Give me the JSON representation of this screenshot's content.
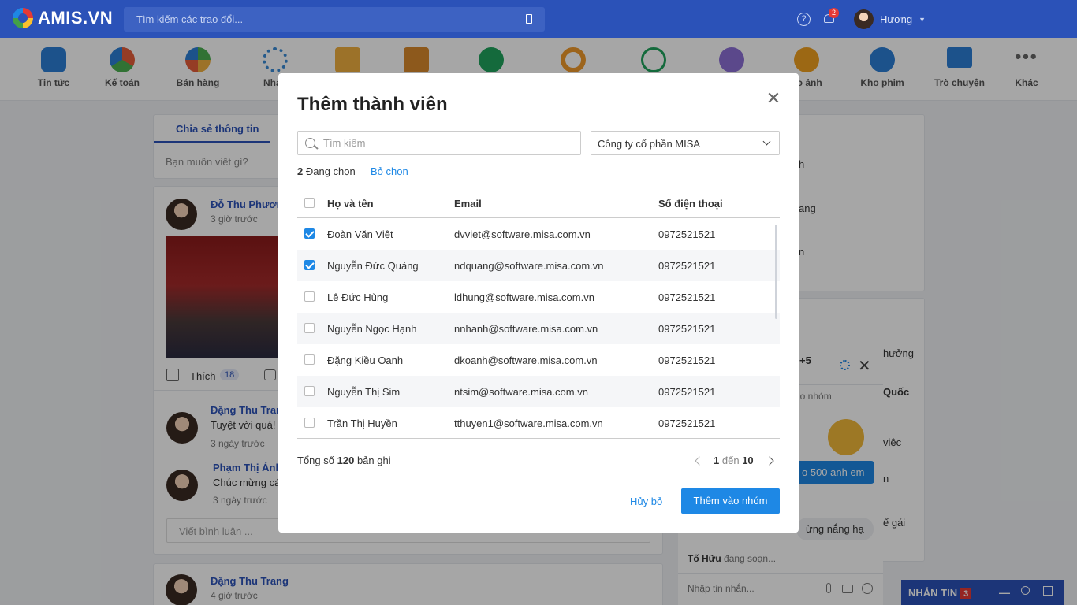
{
  "topbar": {
    "logo": "AMIS.VN",
    "search_placeholder": "Tìm kiếm các trao đổi...",
    "notifications_count": "2",
    "user_name": "Hương"
  },
  "apps": [
    {
      "label": "Tin tức",
      "icon": "news-icon",
      "color": "#2b7fd6"
    },
    {
      "label": "Kế toán",
      "icon": "accounting-icon",
      "color": "#e55d3a"
    },
    {
      "label": "Bán hàng",
      "icon": "sales-icon",
      "color": "#4caf50"
    },
    {
      "label": "Nhân",
      "icon": "hr-icon",
      "color": "#3a8bd6"
    },
    {
      "label": "",
      "icon": "folder-icon",
      "color": "#f0b040"
    },
    {
      "label": "",
      "icon": "box-icon",
      "color": "#d9892b"
    },
    {
      "label": "",
      "icon": "check-icon",
      "color": "#1fa45c"
    },
    {
      "label": "",
      "icon": "ring-icon",
      "color": "#f09a2b"
    },
    {
      "label": "",
      "icon": "download-icon",
      "color": "#1fa45c"
    },
    {
      "label": "",
      "icon": "person-icon",
      "color": "#8c6fd6"
    },
    {
      "label": "ho ảnh",
      "icon": "photo-icon",
      "color": "#f0a020"
    },
    {
      "label": "Kho phim",
      "icon": "video-icon",
      "color": "#2b7fd6"
    },
    {
      "label": "Trò chuyện",
      "icon": "mail-icon",
      "color": "#2b7fd6"
    },
    {
      "label": "Khác",
      "icon": "more-icon",
      "color": "#666666"
    }
  ],
  "feed": {
    "tab": "Chia sẻ thông tin",
    "compose_placeholder": "Bạn muốn viết gì?",
    "post1_author": "Đỗ Thu Phương",
    "post1_time": "3 giờ trước",
    "like_label": "Thích",
    "like_count": "18",
    "c1_author": "Đặng Thu Trang",
    "c1_text": "Tuyệt vời quá! C",
    "c1_time": "3 ngày trước",
    "c2_author": "Phạm Thị Ánh",
    "c2_text": "Chúc mừng cá",
    "c2_time": "3 ngày trước",
    "comment_placeholder": "Viết bình luận ...",
    "post2_author": "Đặng Thu Trang",
    "post2_time": "4 giờ trước"
  },
  "side": {
    "t1": "h",
    "t2": "ang",
    "t3": "n",
    "t4": "hưởng",
    "t5": "Quốc",
    "t6": "việc",
    "t7": "n",
    "t8": "ế gái"
  },
  "chat": {
    "plus": "+5",
    "group_line": "ào nhóm",
    "bubble": "o 500 anh em",
    "msg2": "ừng nắng hạ",
    "typing_name": "Tố Hữu",
    "typing_text": "đang soạn...",
    "input_placeholder": "Nhập tin nhắn..."
  },
  "msgbar": {
    "label": "NHẮN TIN",
    "count": "3"
  },
  "modal": {
    "title": "Thêm thành viên",
    "search_placeholder": "Tìm kiếm",
    "company": "Công ty cổ phần MISA",
    "selected_count": "2",
    "selected_label": "Đang chọn",
    "unselect": "Bỏ chọn",
    "columns": {
      "name": "Họ và tên",
      "email": "Email",
      "phone": "Số điện thoại"
    },
    "rows": [
      {
        "name": "Đoàn Văn Việt",
        "email": "dvviet@software.misa.com.vn",
        "phone": "0972521521",
        "checked": true
      },
      {
        "name": "Nguyễn Đức Quảng",
        "email": "ndquang@software.misa.com.vn",
        "phone": "0972521521",
        "checked": true
      },
      {
        "name": "Lê Đức Hùng",
        "email": "ldhung@software.misa.com.vn",
        "phone": "0972521521",
        "checked": false
      },
      {
        "name": "Nguyễn Ngọc Hạnh",
        "email": "nnhanh@software.misa.com.vn",
        "phone": "0972521521",
        "checked": false
      },
      {
        "name": "Đặng Kiều Oanh",
        "email": "dkoanh@software.misa.com.vn",
        "phone": "0972521521",
        "checked": false
      },
      {
        "name": "Nguyễn Thị Sim",
        "email": "ntsim@software.misa.com.vn",
        "phone": "0972521521",
        "checked": false
      },
      {
        "name": "Trần Thị Huyền",
        "email": "tthuyen1@software.misa.com.vn",
        "phone": "0972521521",
        "checked": false
      }
    ],
    "total_prefix": "Tổng số",
    "total_count": "120",
    "total_suffix": "bản ghi",
    "page_from": "1",
    "page_word": "đến",
    "page_to": "10",
    "cancel": "Hủy bỏ",
    "add": "Thêm vào nhóm"
  }
}
